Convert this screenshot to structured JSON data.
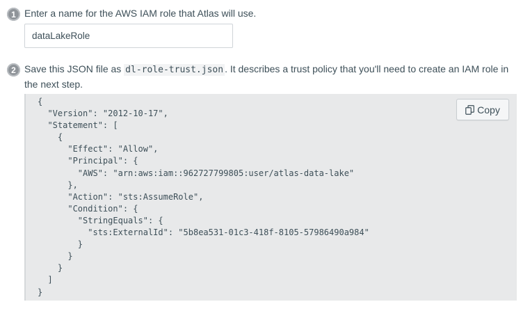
{
  "step1": {
    "number": "1",
    "text": "Enter a name for the AWS IAM role that Atlas will use.",
    "role_name_value": "dataLakeRole"
  },
  "step2": {
    "number": "2",
    "text_before": "Save this JSON file as ",
    "filename": "dl-role-trust.json",
    "text_after": ". It describes a trust policy that you'll need to create an IAM role in the next step."
  },
  "code_block": {
    "copy_label": "Copy",
    "copy_icon": "copy-icon",
    "content": "{\n  \"Version\": \"2012-10-17\",\n  \"Statement\": [\n    {\n      \"Effect\": \"Allow\",\n      \"Principal\": {\n        \"AWS\": \"arn:aws:iam::962727799805:user/atlas-data-lake\"\n      },\n      \"Action\": \"sts:AssumeRole\",\n      \"Condition\": {\n        \"StringEquals\": {\n          \"sts:ExternalId\": \"5b8ea531-01c3-418f-8105-57986490a984\"\n        }\n      }\n    }\n  ]\n}"
  }
}
